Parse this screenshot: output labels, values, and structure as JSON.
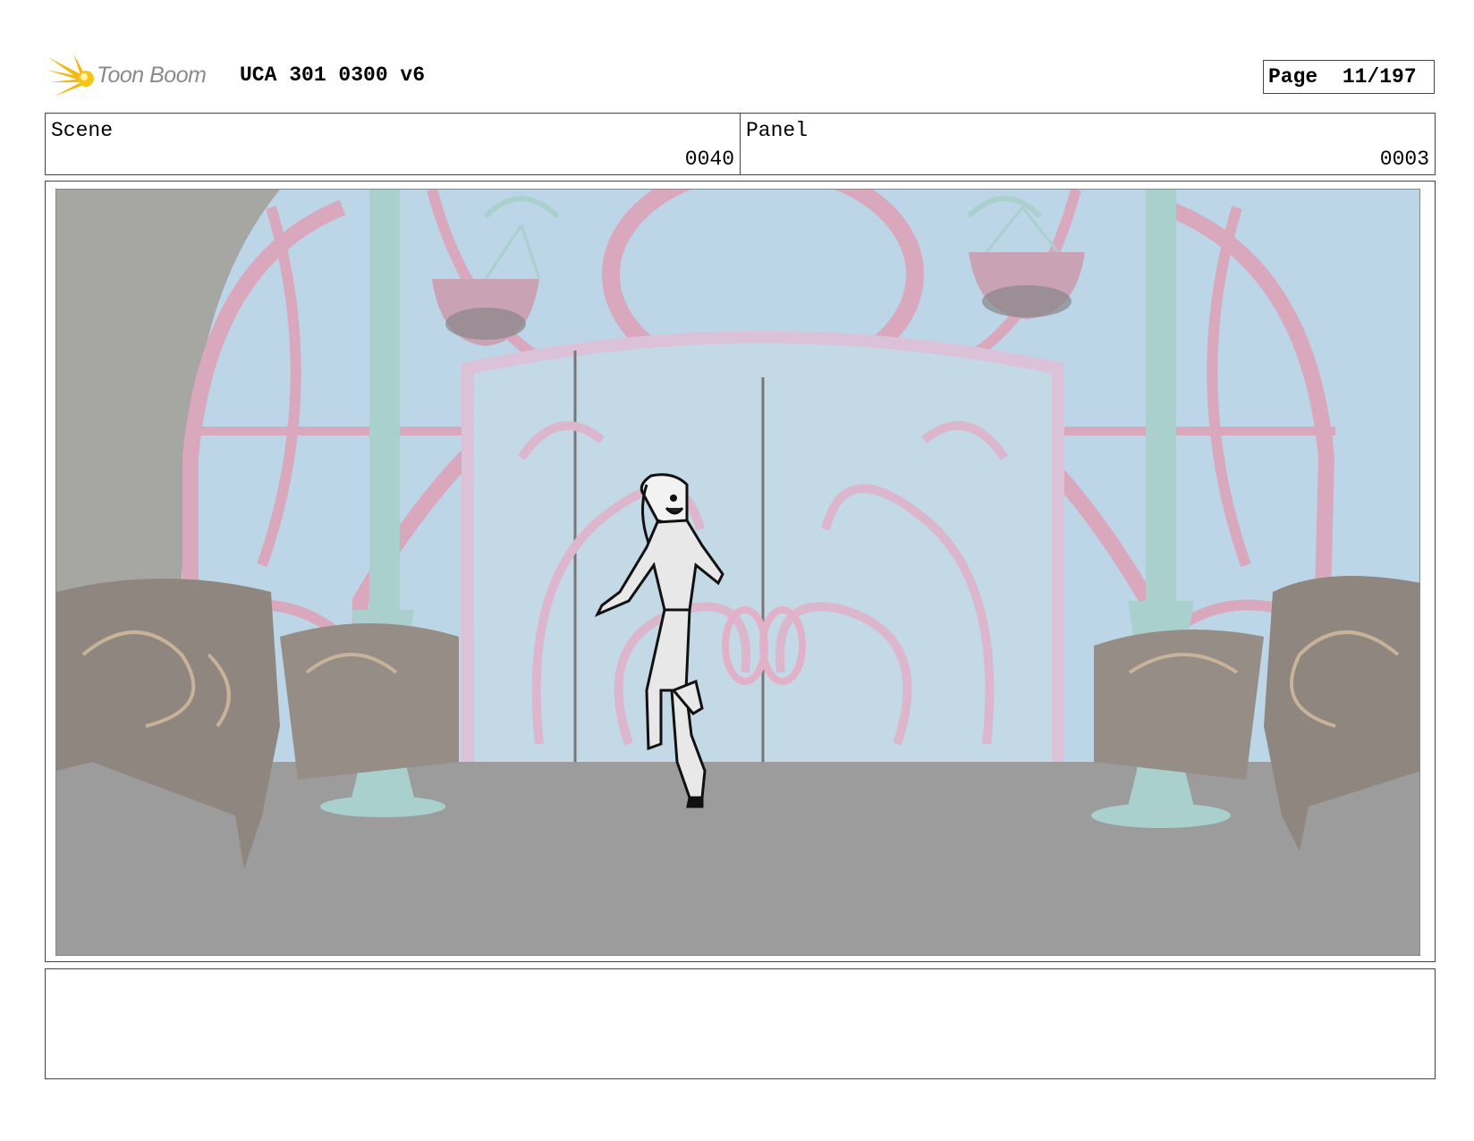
{
  "header": {
    "logo_text": "Toon Boom",
    "title": "UCA 301 0300 v6",
    "page_label": "Page",
    "page_value": "11/197"
  },
  "info": {
    "scene_label": "Scene",
    "scene_value": "0040",
    "panel_label": "Panel",
    "panel_value": "0003"
  },
  "notes": {
    "text": ""
  },
  "colors": {
    "sky": "#bcd6e8",
    "pink_frame": "#d9a8bd",
    "teal_pillar": "#a9d0cc",
    "floor": "#9c9c9c",
    "wall_gray": "#a6a6a2"
  }
}
